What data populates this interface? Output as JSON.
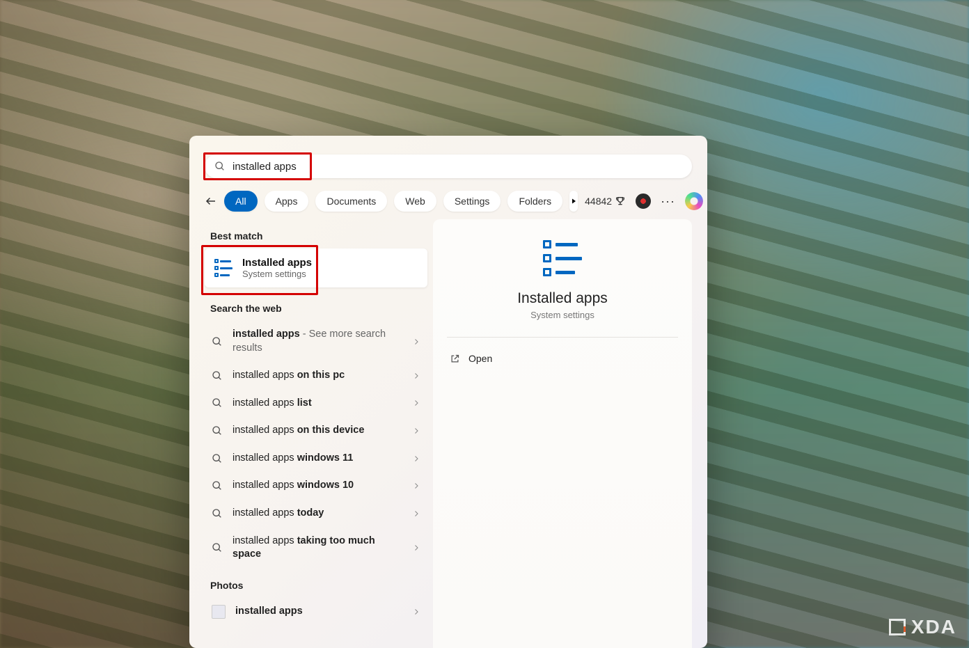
{
  "search": {
    "query": "installed apps"
  },
  "tabs": {
    "items": [
      "All",
      "Apps",
      "Documents",
      "Web",
      "Settings",
      "Folders"
    ],
    "active_index": 0
  },
  "rewards": {
    "points": "44842"
  },
  "best_match": {
    "header": "Best match",
    "title": "Installed apps",
    "subtitle": "System settings"
  },
  "web": {
    "header": "Search the web",
    "items": [
      {
        "prefix": "installed apps",
        "suffix": " - See more search results"
      },
      {
        "prefix": "installed apps ",
        "suffix": "on this pc"
      },
      {
        "prefix": "installed apps ",
        "suffix": "list"
      },
      {
        "prefix": "installed apps ",
        "suffix": "on this device"
      },
      {
        "prefix": "installed apps ",
        "suffix": "windows 11"
      },
      {
        "prefix": "installed apps ",
        "suffix": "windows 10"
      },
      {
        "prefix": "installed apps ",
        "suffix": "today"
      },
      {
        "prefix": "installed apps ",
        "suffix": "taking too much space"
      }
    ]
  },
  "photos": {
    "header": "Photos",
    "item": "installed apps"
  },
  "detail": {
    "title": "Installed apps",
    "subtitle": "System settings",
    "open_label": "Open"
  },
  "watermark": {
    "text": "XDA"
  }
}
